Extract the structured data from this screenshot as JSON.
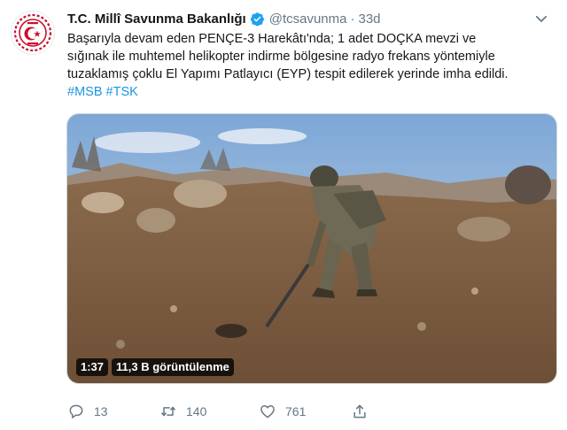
{
  "tweet": {
    "display_name": "T.C. Millî Savunma Bakanlığı",
    "handle": "@tcsavunma",
    "separator": "·",
    "time": "33d",
    "text_lines": [
      "Başarıyla devam eden PENÇE-3 Harekâtı'nda; 1 adet DOÇKA  mevzi ve",
      "sığınak ile muhtemel helikopter indirme bölgesine radyo frekans yöntemiyle",
      "tuzaklamış çoklu  El Yapımı Patlayıcı (EYP) tespit edilerek yerinde imha edildi."
    ],
    "hashtags": [
      "#MSB",
      "#TSK"
    ]
  },
  "video": {
    "duration": "1:37",
    "views": "11,3 B görüntülenme"
  },
  "actions": {
    "reply_count": "13",
    "retweet_count": "140",
    "like_count": "761"
  },
  "icons": {
    "verified": "verified-badge-icon",
    "caret": "chevron-down-icon",
    "reply": "reply-icon",
    "retweet": "retweet-icon",
    "like": "heart-icon",
    "share": "share-icon"
  },
  "colors": {
    "text": "#14171a",
    "muted": "#657786",
    "link": "#1b95e0",
    "verified": "#1da1f2",
    "logo_red": "#c8102e"
  }
}
